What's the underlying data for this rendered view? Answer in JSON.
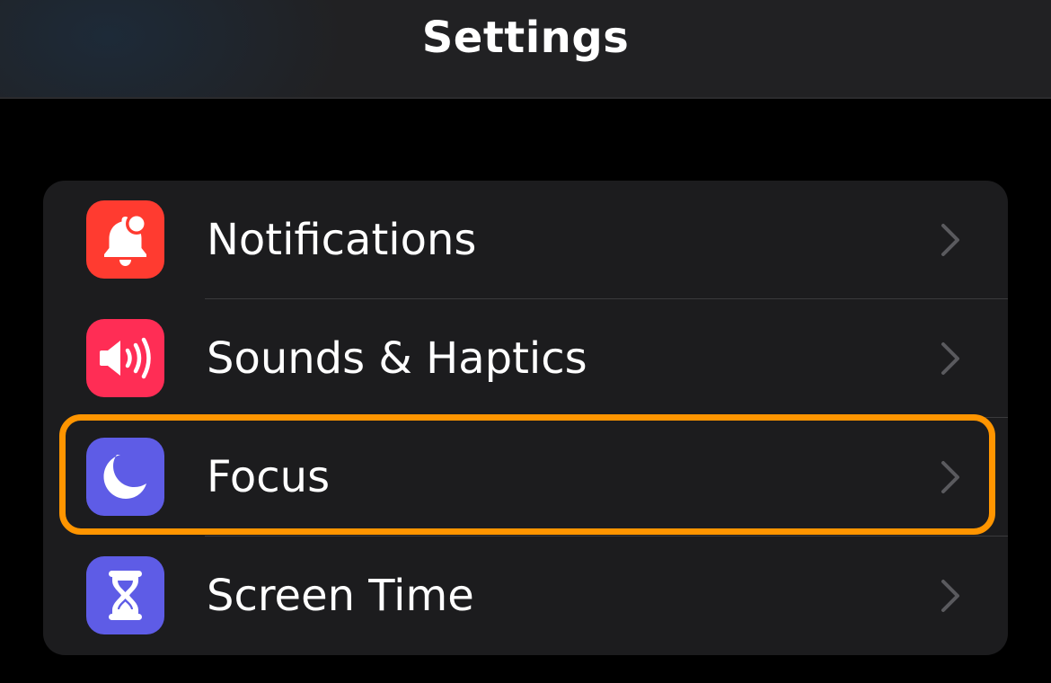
{
  "header": {
    "title": "Settings"
  },
  "settings_group": {
    "items": [
      {
        "label": "Notifications",
        "icon": "bell-badge-icon",
        "icon_color": "#ff3b30",
        "highlighted": false
      },
      {
        "label": "Sounds & Haptics",
        "icon": "speaker-wave-icon",
        "icon_color": "#ff2d55",
        "highlighted": false
      },
      {
        "label": "Focus",
        "icon": "moon-icon",
        "icon_color": "#5e5ce6",
        "highlighted": true
      },
      {
        "label": "Screen Time",
        "icon": "hourglass-icon",
        "icon_color": "#5e5ce6",
        "highlighted": false
      }
    ]
  },
  "colors": {
    "background": "#000000",
    "group_background": "#1c1c1e",
    "highlight_outline": "#ff9500",
    "chevron": "#5a5a5e"
  }
}
